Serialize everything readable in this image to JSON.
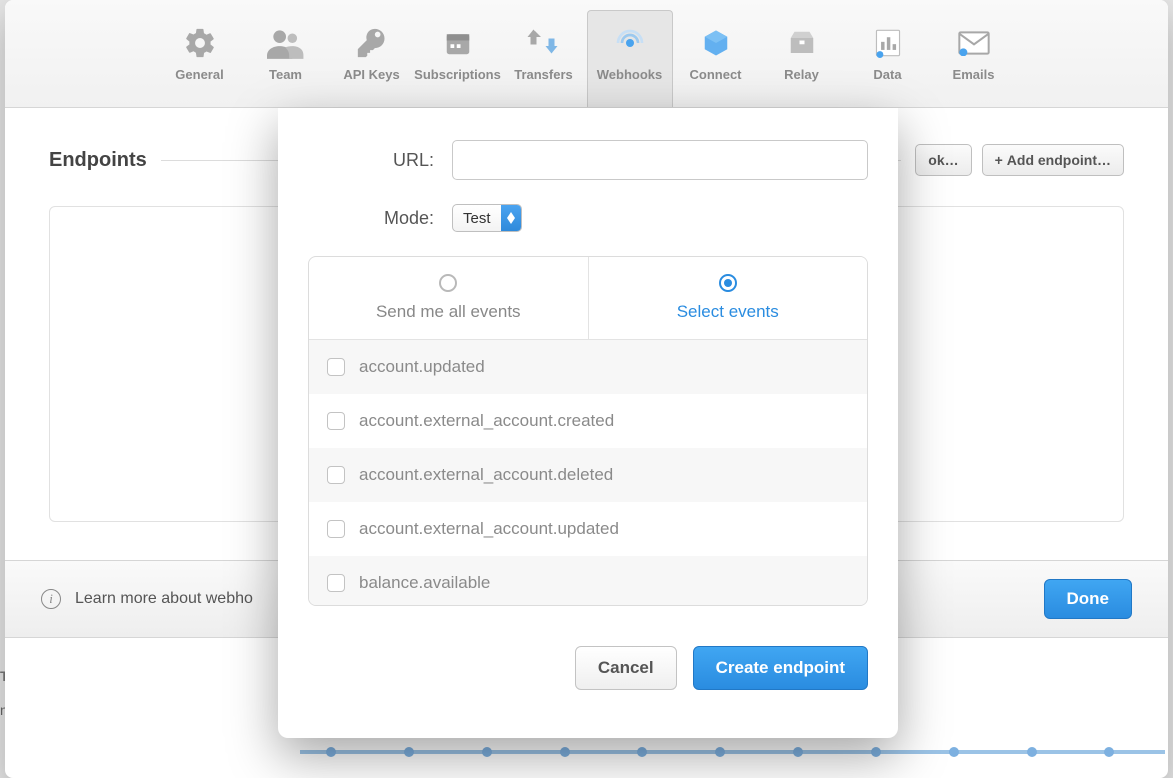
{
  "tabs": [
    {
      "id": "general",
      "label": "General"
    },
    {
      "id": "team",
      "label": "Team"
    },
    {
      "id": "apikeys",
      "label": "API Keys"
    },
    {
      "id": "subscriptions",
      "label": "Subscriptions"
    },
    {
      "id": "transfers",
      "label": "Transfers"
    },
    {
      "id": "webhooks",
      "label": "Webhooks",
      "active": true
    },
    {
      "id": "connect",
      "label": "Connect"
    },
    {
      "id": "relay",
      "label": "Relay"
    },
    {
      "id": "data",
      "label": "Data"
    },
    {
      "id": "emails",
      "label": "Emails"
    }
  ],
  "section": {
    "title": "Endpoints",
    "truncated_button": "ok…",
    "add_button": "Add endpoint…"
  },
  "footer": {
    "learn_text": "Learn more about webho",
    "done": "Done"
  },
  "background": {
    "tions": "TIONS",
    "ns": "ns"
  },
  "modal": {
    "url_label": "URL:",
    "url_value": "",
    "mode_label": "Mode:",
    "mode_value": "Test",
    "event_tabs": {
      "all": "Send me all events",
      "select": "Select events"
    },
    "events": [
      "account.updated",
      "account.external_account.created",
      "account.external_account.deleted",
      "account.external_account.updated",
      "balance.available"
    ],
    "cancel": "Cancel",
    "create": "Create endpoint"
  }
}
